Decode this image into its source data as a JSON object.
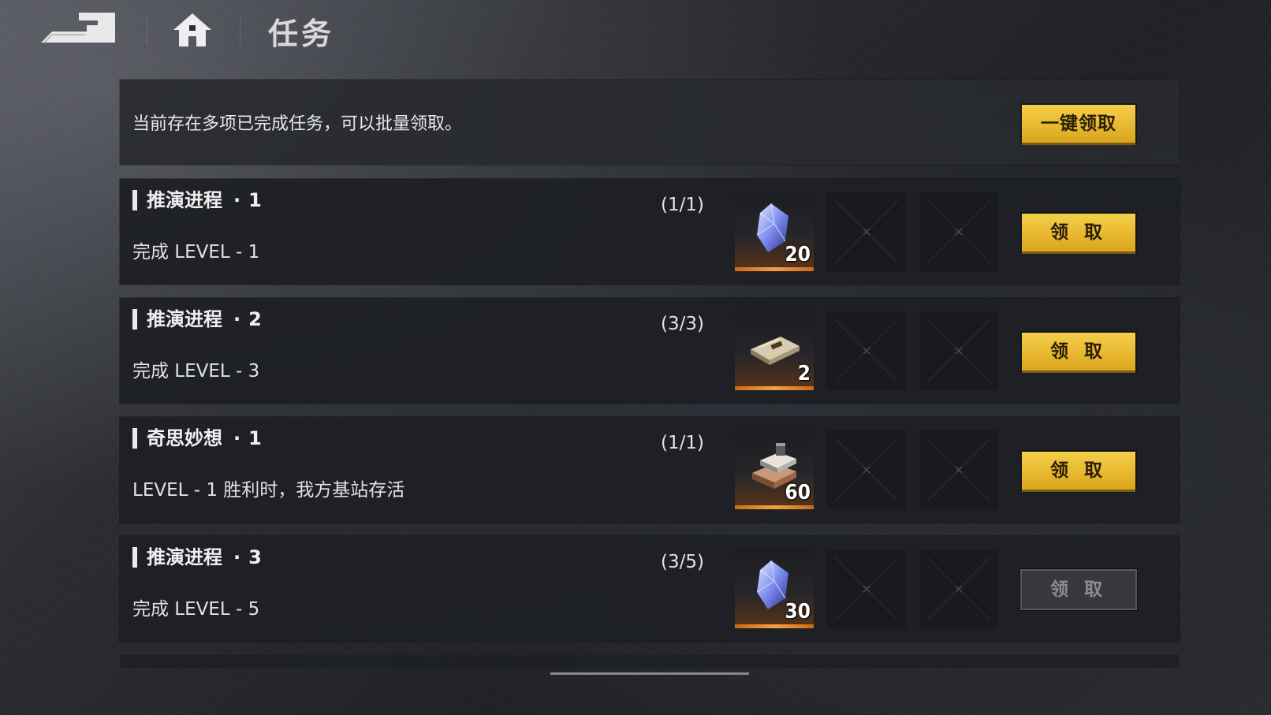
{
  "header": {
    "title": "任务",
    "back_icon": "back-arrow-icon",
    "home_icon": "home-icon"
  },
  "banner": {
    "text": "当前存在多项已完成任务，可以批量领取。",
    "claim_all_label": "一键领取"
  },
  "tasks": [
    {
      "name": "推演进程",
      "index": "1",
      "description": "完成 LEVEL - 1",
      "progress": "(1/1)",
      "reward_icon": "crystal-icon",
      "reward_count": "20",
      "claim_label": "领 取",
      "claimable": true
    },
    {
      "name": "推演进程",
      "index": "2",
      "description": "完成 LEVEL - 3",
      "progress": "(3/3)",
      "reward_icon": "plate-icon",
      "reward_count": "2",
      "claim_label": "领 取",
      "claimable": true
    },
    {
      "name": "奇思妙想",
      "index": "1",
      "description": "LEVEL - 1 胜利时，我方基站存活",
      "progress": "(1/1)",
      "reward_icon": "metal-ingot-icon",
      "reward_count": "60",
      "claim_label": "领 取",
      "claimable": true
    },
    {
      "name": "推演进程",
      "index": "3",
      "description": "完成 LEVEL - 5",
      "progress": "(3/5)",
      "reward_icon": "crystal-icon",
      "reward_count": "30",
      "claim_label": "领 取",
      "claimable": false
    }
  ],
  "colors": {
    "accent_gold": "#e8b830",
    "reward_bar": "#f3a046",
    "disabled": "#36383d"
  }
}
